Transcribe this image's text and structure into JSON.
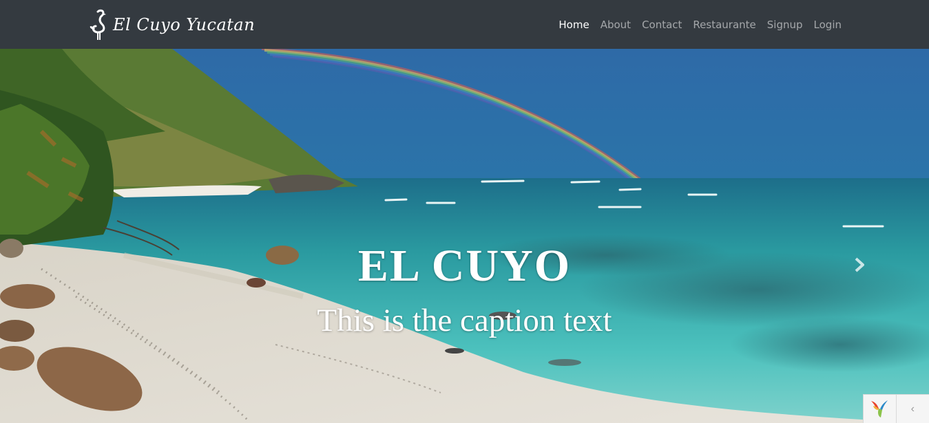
{
  "brand": {
    "name": "El Cuyo Yucatan",
    "logo_icon": "flamingo-icon"
  },
  "nav": {
    "items": [
      {
        "label": "Home",
        "active": true
      },
      {
        "label": "About",
        "active": false
      },
      {
        "label": "Contact",
        "active": false
      },
      {
        "label": "Restaurante",
        "active": false
      },
      {
        "label": "Signup",
        "active": false
      },
      {
        "label": "Login",
        "active": false
      }
    ]
  },
  "carousel": {
    "slide": {
      "title": "EL CUYO",
      "caption": "This is the caption text",
      "image": "beach-rainbow-photo"
    },
    "next_icon": "chevron-right-icon"
  },
  "debug_toolbar": {
    "logo_icon": "yii-logo-icon",
    "toggle_icon": "chevron-left-icon",
    "toggle_glyph": "‹"
  },
  "colors": {
    "navbar": "#343a40",
    "nav_active": "#ffffff",
    "nav_inactive": "#9a9da0"
  }
}
